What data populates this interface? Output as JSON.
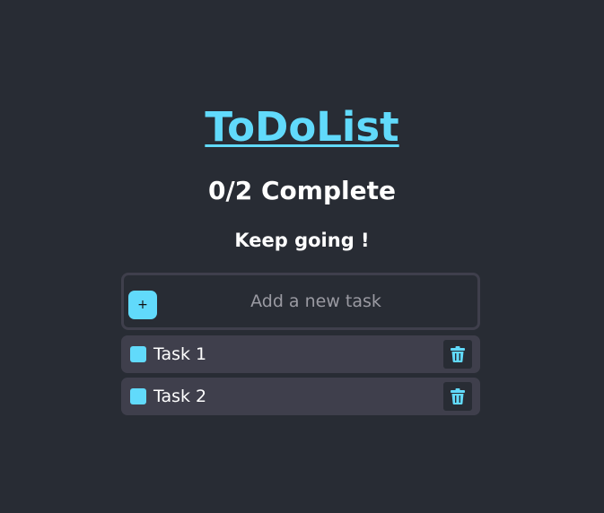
{
  "app": {
    "title": "ToDoList",
    "accent_color": "#61dafb",
    "background_color": "#282c34"
  },
  "progress": {
    "text": "0/2 Complete",
    "completed": 0,
    "total": 2
  },
  "motivation": "Keep going !",
  "add_task": {
    "button_label": "+",
    "placeholder": "Add a new task",
    "value": ""
  },
  "tasks": [
    {
      "label": "Task 1",
      "completed": false,
      "delete_icon": "trash-icon"
    },
    {
      "label": "Task 2",
      "completed": false,
      "delete_icon": "trash-icon"
    }
  ]
}
